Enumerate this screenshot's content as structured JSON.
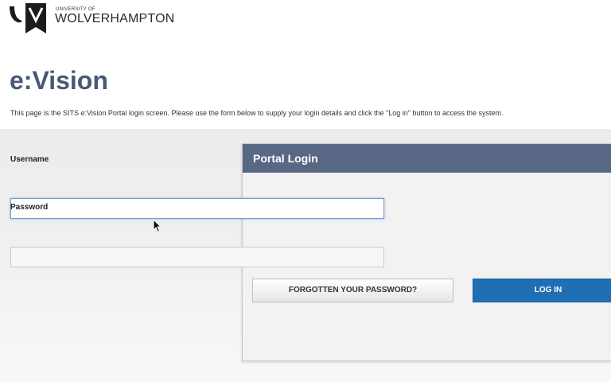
{
  "header": {
    "logo_small_text": "UNIVERSITY OF",
    "logo_main_text": "WOLVERHAMPTON"
  },
  "page": {
    "title": "e:Vision",
    "intro": "This page is the SITS e:Vision Portal login screen. Please use the form below to supply your login details and click the \"Log in\" button to access the system."
  },
  "login_panel": {
    "title": "Portal Login",
    "username_label": "Username",
    "username_value": "",
    "password_label": "Password",
    "password_value": "",
    "forgot_button_label": "FORGOTTEN YOUR PASSWORD?",
    "login_button_label": "LOG IN"
  },
  "colors": {
    "title_text": "#4a5775",
    "panel_header": "#586784",
    "login_button": "#1f6fb5"
  },
  "icons": {
    "logo": "wolverhampton-logo-icon",
    "cursor": "mouse-pointer-icon"
  }
}
